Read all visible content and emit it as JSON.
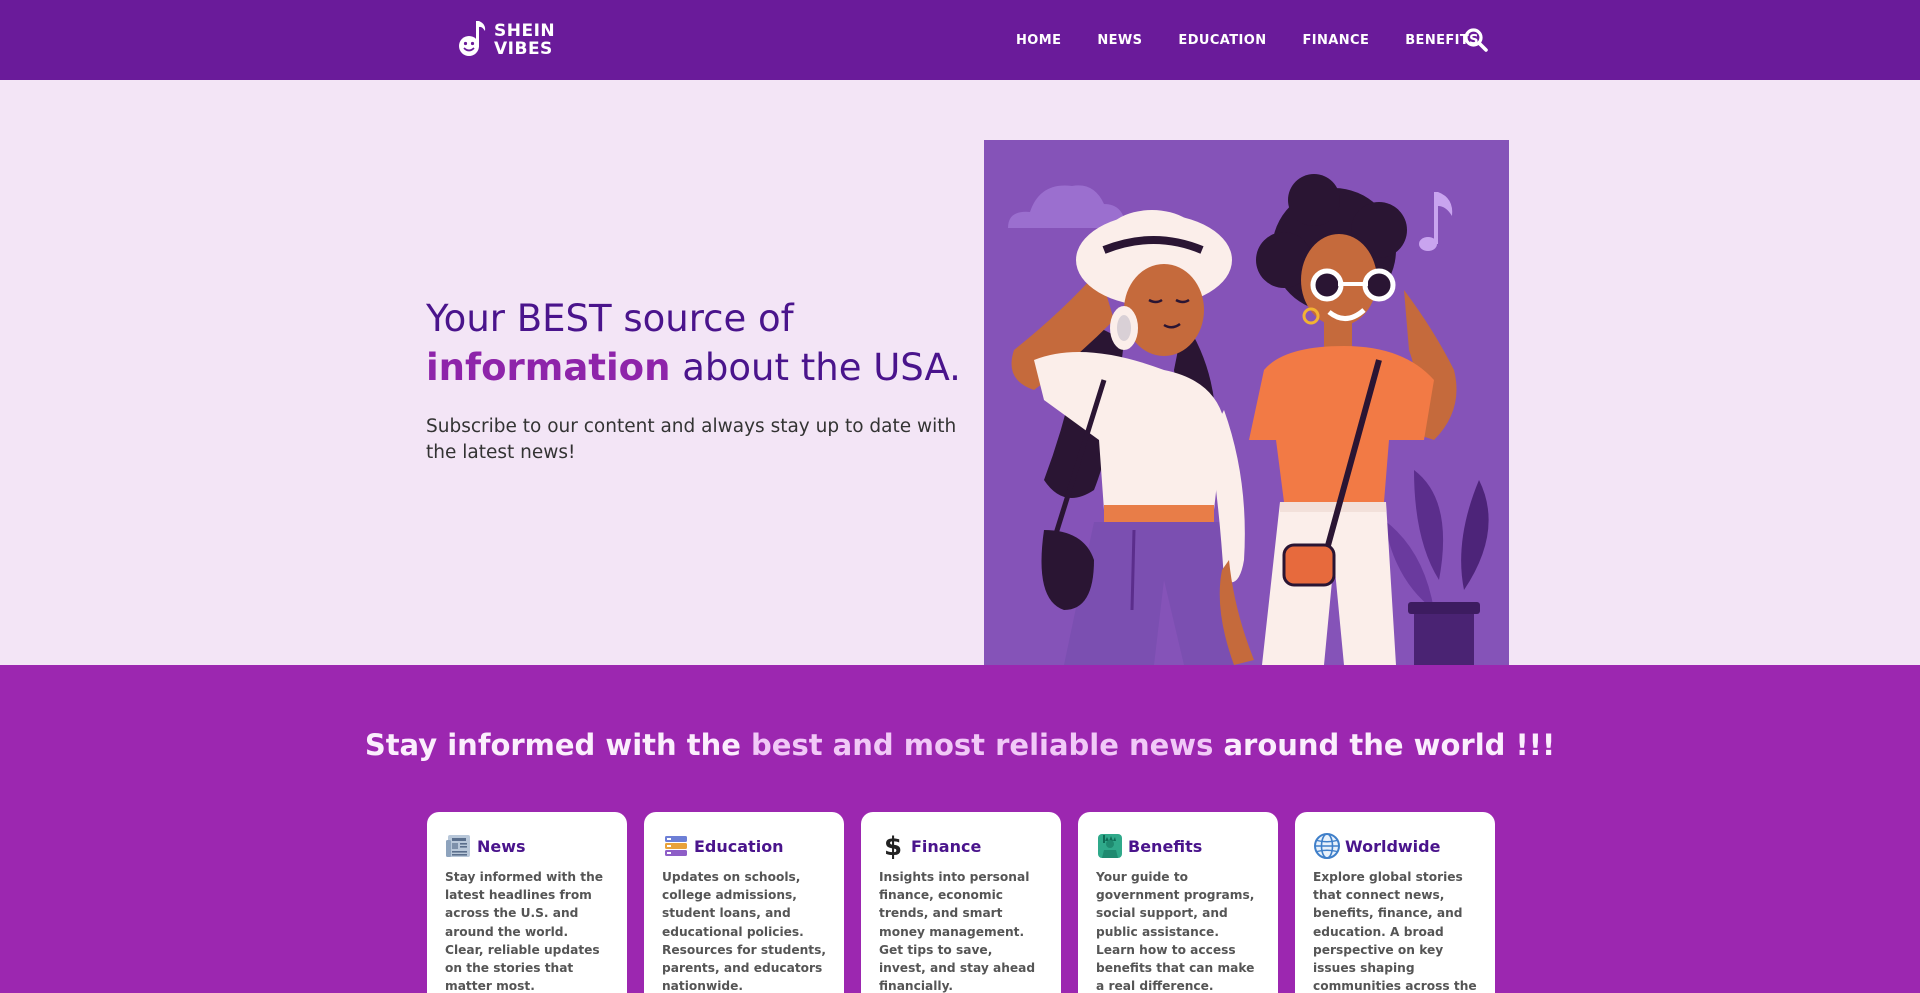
{
  "brand": {
    "line1": "SHEIN",
    "line2": "VIBES"
  },
  "nav": {
    "items": [
      {
        "label": "HOME"
      },
      {
        "label": "NEWS"
      },
      {
        "label": "EDUCATION"
      },
      {
        "label": "FINANCE"
      },
      {
        "label": "BENEFITS"
      }
    ],
    "search_icon": "search-icon"
  },
  "hero": {
    "title_part1": "Your BEST source of",
    "title_accent": "information",
    "title_part2": " about the USA.",
    "subtitle": "Subscribe to our content and always stay up to date with the latest news!",
    "image": "two-women-illustration"
  },
  "band": {
    "title_pre": "Stay informed with the ",
    "title_strong": "best and most reliable news",
    "title_post": " around the world !!!"
  },
  "cards": [
    {
      "icon": "newspaper-icon",
      "title": "News",
      "desc": "Stay informed with the latest headlines from across the U.S. and around the world. Clear, reliable updates on the stories that matter most."
    },
    {
      "icon": "books-icon",
      "title": "Education",
      "desc": "Updates on schools, college admissions, student loans, and educational policies. Resources for students, parents, and educators nationwide."
    },
    {
      "icon": "dollar-icon",
      "title": "Finance",
      "desc": "Insights into personal finance, economic trends, and smart money management. Get tips to save, invest, and stay ahead financially."
    },
    {
      "icon": "statue-of-liberty-icon",
      "title": "Benefits",
      "desc": "Your guide to government programs, social support, and public assistance. Learn how to access benefits that can make a real difference."
    },
    {
      "icon": "globe-icon",
      "title": "Worldwide",
      "desc": "Explore global stories that connect news, benefits, finance, and education. A broad perspective on key issues shaping communities across the globe."
    }
  ],
  "colors": {
    "header_bg": "#6a1b9a",
    "hero_bg": "#f3e5f6",
    "band_bg": "#9c27b0",
    "accent": "#8e24aa",
    "title": "#4a148c"
  }
}
